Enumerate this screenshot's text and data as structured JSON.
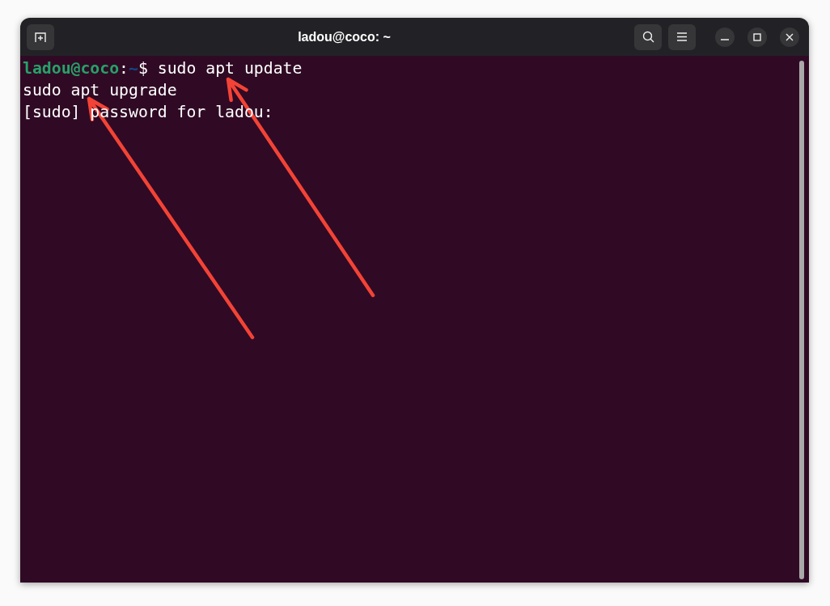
{
  "window": {
    "title": "ladou@coco: ~"
  },
  "terminal": {
    "lines": [
      [
        {
          "kind": "user",
          "text": "ladou@coco"
        },
        {
          "kind": "plain",
          "text": ":"
        },
        {
          "kind": "path",
          "text": "~"
        },
        {
          "kind": "plain",
          "text": "$ sudo apt update"
        }
      ],
      [
        {
          "kind": "plain",
          "text": "sudo apt upgrade"
        }
      ],
      [
        {
          "kind": "plain",
          "text": "[sudo] password for ladou:"
        }
      ]
    ]
  },
  "annotations": [
    {
      "kind": "arrow"
    },
    {
      "kind": "arrow"
    }
  ]
}
